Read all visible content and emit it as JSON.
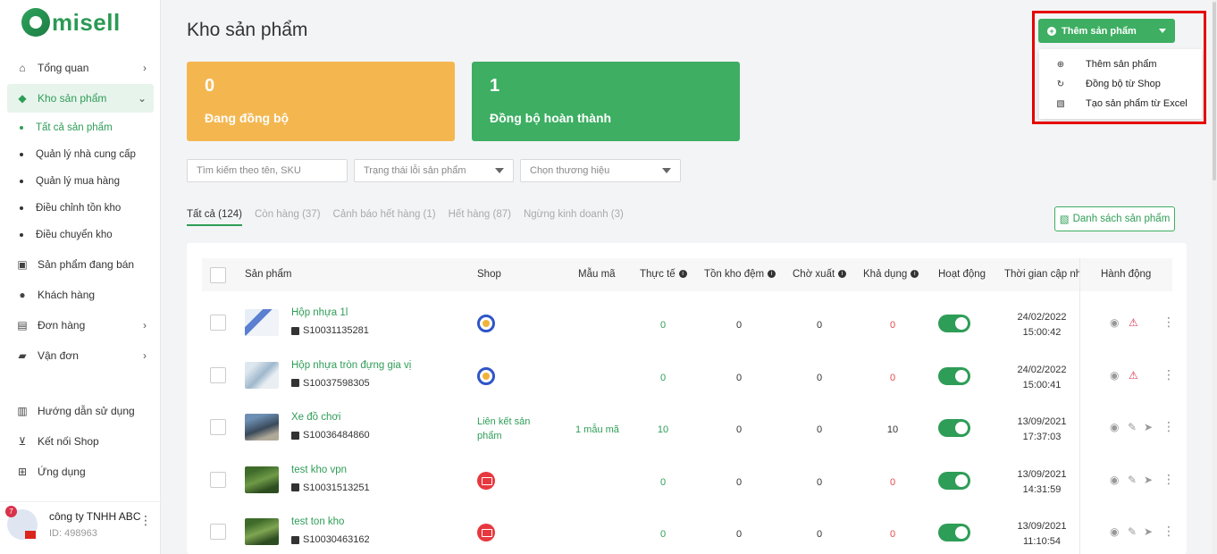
{
  "brand": {
    "logo_text": "misell",
    "accent": "#3dae62"
  },
  "sidebar": {
    "items": [
      {
        "label": "Tổng quan",
        "icon": "home-icon"
      },
      {
        "label": "Kho sản phẩm",
        "icon": "box-icon"
      },
      {
        "label": "Sản phẩm đang bán",
        "icon": "shop-bag-icon"
      },
      {
        "label": "Khách hàng",
        "icon": "users-icon"
      },
      {
        "label": "Đơn hàng",
        "icon": "order-icon"
      },
      {
        "label": "Vận đơn",
        "icon": "truck-icon"
      },
      {
        "label": "Hướng dẫn sử dụng",
        "icon": "map-icon"
      },
      {
        "label": "Kết nối Shop",
        "icon": "cart-icon"
      },
      {
        "label": "Ứng dụng",
        "icon": "apps-icon"
      }
    ],
    "sub_items": [
      {
        "label": "Tất cả sản phẩm"
      },
      {
        "label": "Quản lý nhà cung cấp"
      },
      {
        "label": "Quản lý mua hàng"
      },
      {
        "label": "Điều chỉnh tồn kho"
      },
      {
        "label": "Điều chuyển kho"
      }
    ]
  },
  "account": {
    "name": "công ty TNHH ABC",
    "id": "ID: 498963",
    "badge": "7"
  },
  "page": {
    "title": "Kho sản phẩm"
  },
  "cards": [
    {
      "number": "0",
      "label": "Đang đồng bộ"
    },
    {
      "number": "1",
      "label": "Đồng bộ hoàn thành"
    }
  ],
  "filters": {
    "search_placeholder": "Tìm kiếm theo tên, SKU",
    "error_status": "Trạng thái lỗi sản phẩm",
    "brand": "Chọn thương hiệu"
  },
  "tabs": [
    {
      "label": "Tất cả (124)"
    },
    {
      "label": "Còn hàng (37)"
    },
    {
      "label": "Cảnh báo hết hàng (1)"
    },
    {
      "label": "Hết hàng (87)"
    },
    {
      "label": "Ngừng kinh doanh (3)"
    }
  ],
  "product_list_button": "Danh sách sản phẩm",
  "add_button": {
    "label": "Thêm sản phẩm",
    "menu": [
      {
        "label": "Thêm sản phẩm"
      },
      {
        "label": "Đồng bộ từ Shop"
      },
      {
        "label": "Tạo sản phẩm từ Excel"
      }
    ]
  },
  "table": {
    "headers": {
      "product": "Sản phẩm",
      "shop": "Shop",
      "variant": "Mẫu mã",
      "actual": "Thực tế",
      "buffer": "Tồn kho đệm",
      "pending": "Chờ xuất",
      "available": "Khả dụng",
      "active": "Hoạt động",
      "updated": "Thời gian cập nhật",
      "actions": "Hành động"
    },
    "rows": [
      {
        "name": "Hộp nhựa 1l",
        "sku": "S10031135281",
        "shop": "blue",
        "shop_text": "",
        "variant": "",
        "actual": "0",
        "buffer": "0",
        "pending": "0",
        "available": "0",
        "date": "24/02/2022",
        "time": "15:00:42",
        "warn": true
      },
      {
        "name": "Hộp nhựa tròn đựng gia vị",
        "sku": "S10037598305",
        "shop": "blue",
        "shop_text": "",
        "variant": "",
        "actual": "0",
        "buffer": "0",
        "pending": "0",
        "available": "0",
        "date": "24/02/2022",
        "time": "15:00:41",
        "warn": true
      },
      {
        "name": "Xe đồ chơi",
        "sku": "S10036484860",
        "shop": "none",
        "shop_text": "Liên kết sản phẩm",
        "variant": "1 mẫu mã",
        "actual": "10",
        "buffer": "0",
        "pending": "0",
        "available": "10",
        "date": "13/09/2021",
        "time": "17:37:03",
        "warn": false
      },
      {
        "name": "test kho vpn",
        "sku": "S10031513251",
        "shop": "red",
        "shop_text": "",
        "variant": "",
        "actual": "0",
        "buffer": "0",
        "pending": "0",
        "available": "0",
        "date": "13/09/2021",
        "time": "14:31:59",
        "warn": false
      },
      {
        "name": "test ton kho",
        "sku": "S10030463162",
        "shop": "red",
        "shop_text": "",
        "variant": "",
        "actual": "0",
        "buffer": "0",
        "pending": "0",
        "available": "0",
        "date": "13/09/2021",
        "time": "11:10:54",
        "warn": false
      }
    ]
  }
}
